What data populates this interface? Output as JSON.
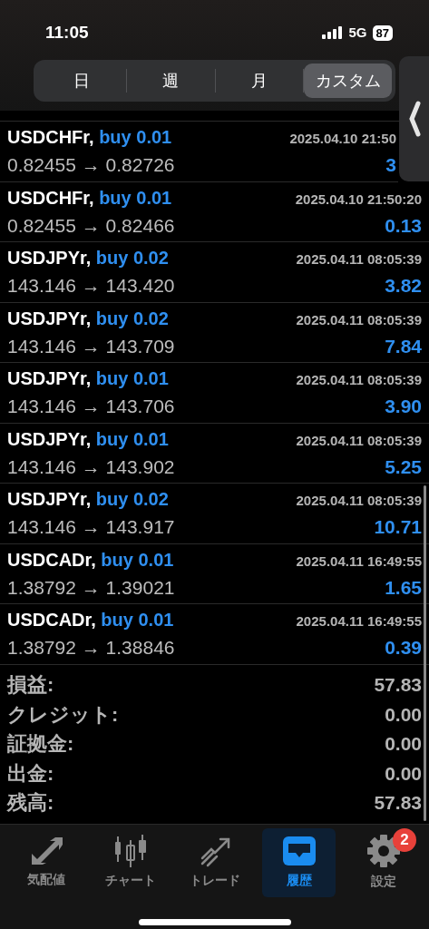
{
  "status_bar": {
    "time": "11:05",
    "network": "5G",
    "battery": "87"
  },
  "period_tabs": [
    {
      "label": "日",
      "selected": false
    },
    {
      "label": "週",
      "selected": false
    },
    {
      "label": "月",
      "selected": false
    },
    {
      "label": "カスタム",
      "selected": true
    }
  ],
  "deals": [
    {
      "symbol": "USDCHFr,",
      "side": "buy 0.01",
      "time": "2025.04.10 21:50",
      "prices": "0.82455 → 0.82726",
      "profit": "3"
    },
    {
      "symbol": "USDCHFr,",
      "side": "buy 0.01",
      "time": "2025.04.10 21:50:20",
      "prices": "0.82455 → 0.82466",
      "profit": "0.13"
    },
    {
      "symbol": "USDJPYr,",
      "side": "buy 0.02",
      "time": "2025.04.11 08:05:39",
      "prices": "143.146 → 143.420",
      "profit": "3.82"
    },
    {
      "symbol": "USDJPYr,",
      "side": "buy 0.02",
      "time": "2025.04.11 08:05:39",
      "prices": "143.146 → 143.709",
      "profit": "7.84"
    },
    {
      "symbol": "USDJPYr,",
      "side": "buy 0.01",
      "time": "2025.04.11 08:05:39",
      "prices": "143.146 → 143.706",
      "profit": "3.90"
    },
    {
      "symbol": "USDJPYr,",
      "side": "buy 0.01",
      "time": "2025.04.11 08:05:39",
      "prices": "143.146 → 143.902",
      "profit": "5.25"
    },
    {
      "symbol": "USDJPYr,",
      "side": "buy 0.02",
      "time": "2025.04.11 08:05:39",
      "prices": "143.146 → 143.917",
      "profit": "10.71"
    },
    {
      "symbol": "USDCADr,",
      "side": "buy 0.01",
      "time": "2025.04.11 16:49:55",
      "prices": "1.38792 → 1.39021",
      "profit": "1.65"
    },
    {
      "symbol": "USDCADr,",
      "side": "buy 0.01",
      "time": "2025.04.11 16:49:55",
      "prices": "1.38792 → 1.38846",
      "profit": "0.39"
    }
  ],
  "summary": [
    {
      "label": "損益:",
      "value": "57.83"
    },
    {
      "label": "クレジット:",
      "value": "0.00"
    },
    {
      "label": "証拠金:",
      "value": "0.00"
    },
    {
      "label": "出金:",
      "value": "0.00"
    },
    {
      "label": "残高:",
      "value": "57.83"
    }
  ],
  "tab_bar": [
    {
      "kind": "quotes",
      "label": "気配値",
      "selected": false
    },
    {
      "kind": "chart",
      "label": "チャート",
      "selected": false
    },
    {
      "kind": "trade",
      "label": "トレード",
      "selected": false
    },
    {
      "kind": "history",
      "label": "履歴",
      "selected": true
    },
    {
      "kind": "settings",
      "label": "設定",
      "selected": false,
      "badge": "2"
    }
  ]
}
